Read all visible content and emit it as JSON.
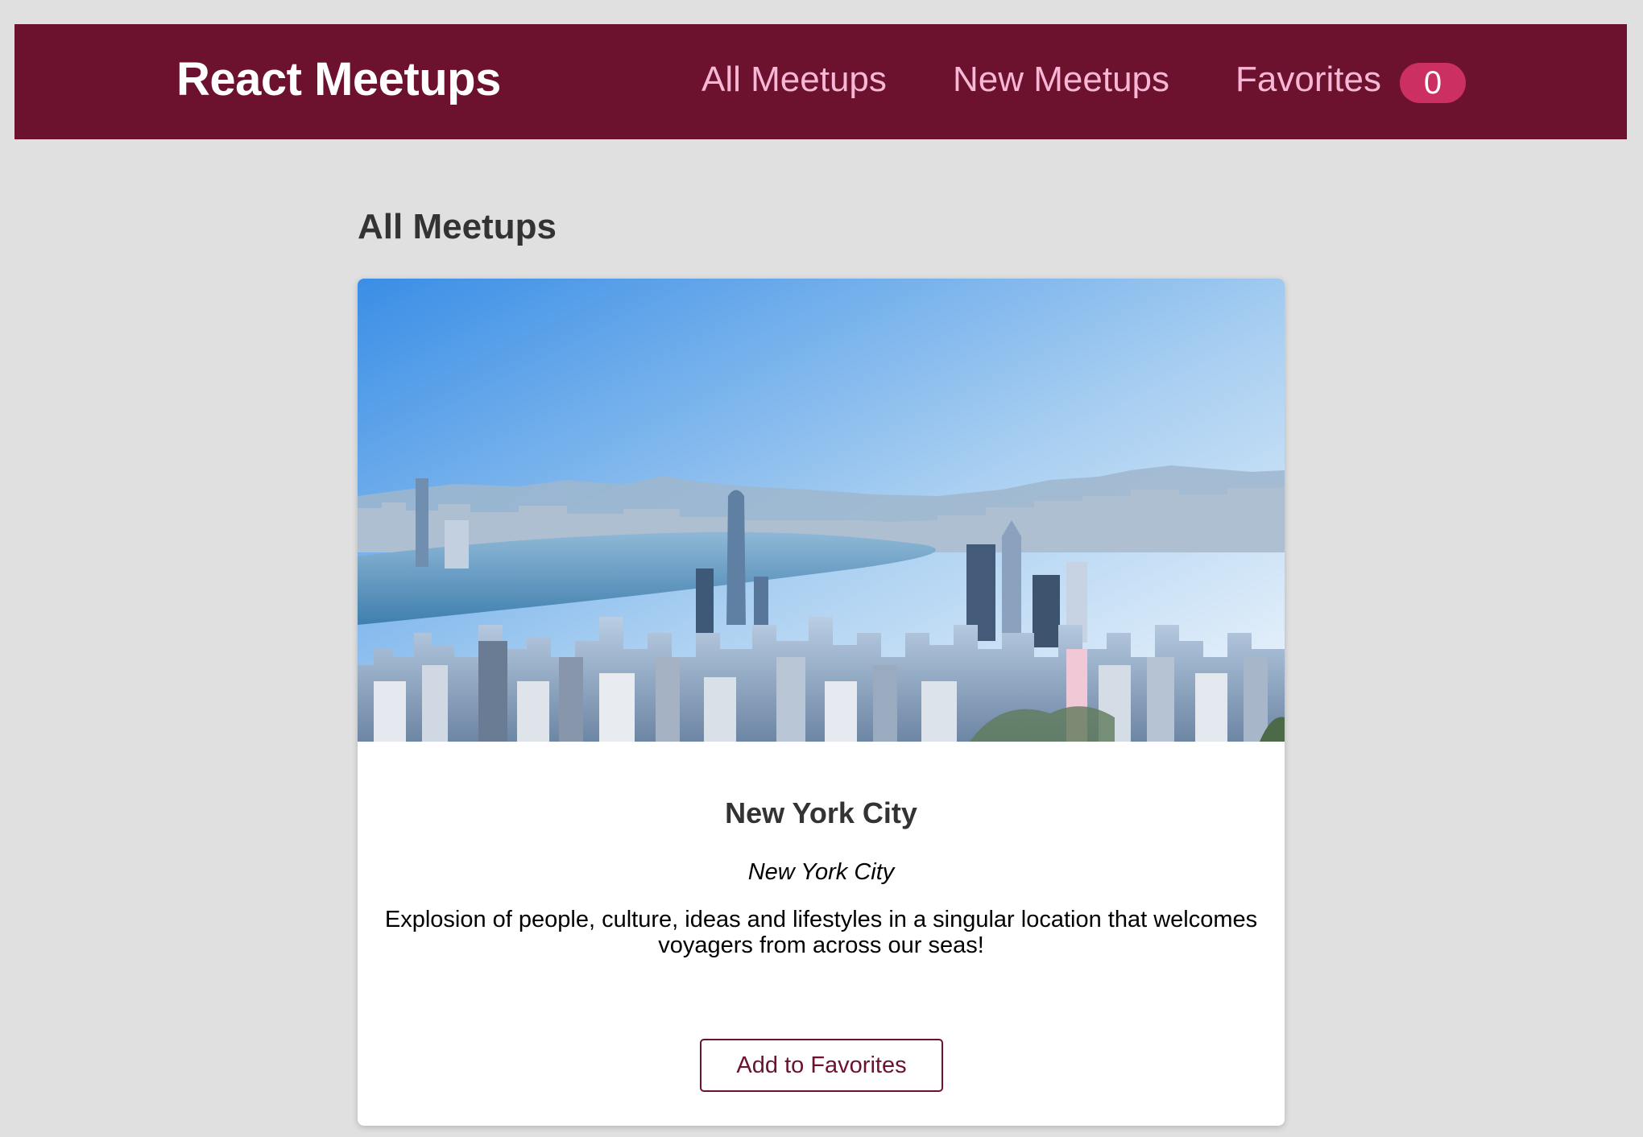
{
  "header": {
    "logo": "React Meetups",
    "nav": {
      "all_meetups": "All Meetups",
      "new_meetups": "New Meetups",
      "favorites": "Favorites",
      "favorites_count": "0"
    }
  },
  "main": {
    "title": "All Meetups",
    "meetups": [
      {
        "title": "New York City",
        "address": "New York City",
        "description": "Explosion of people, culture, ideas and lifestyles in a singular location that welcomes voyagers from across our seas!",
        "button_label": "Add to Favorites",
        "image_subject": "city-skyline-photo"
      }
    ]
  },
  "colors": {
    "header_bg": "#6c112e",
    "nav_link": "#f8b8d5",
    "badge_bg": "#cc2f62",
    "page_bg": "#e0e0e0"
  }
}
